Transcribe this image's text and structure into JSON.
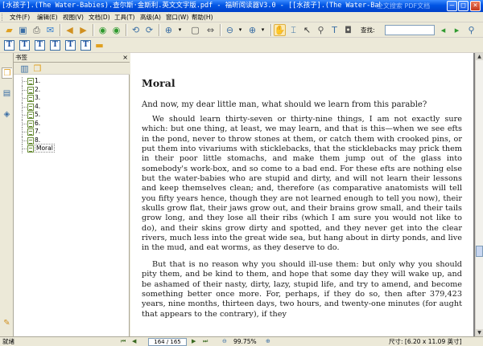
{
  "window": {
    "title": "[水孩子].(The Water-Babies).查尔斯·金斯利.英文文字版.pdf - 福昕阅读器V3.0 - [[水孩子].(The Water-Babies).查尔斯·金斯利...",
    "watermark": "全文搜索 PDF文档"
  },
  "menu": [
    "文件(F)",
    "编辑(E)",
    "视图(V)",
    "文档(D)",
    "工具(T)",
    "高级(A)",
    "窗口(W)",
    "帮助(H)"
  ],
  "toolbar": {
    "find_label": "查找:",
    "find_value": ""
  },
  "panel": {
    "title": "书签",
    "close": "×",
    "bookmarks": [
      "1.",
      "2.",
      "3.",
      "4.",
      "5.",
      "6.",
      "7.",
      "8.",
      "Moral"
    ],
    "selected_index": 8
  },
  "page": {
    "heading": "Moral",
    "intro": "And now, my dear little man, what should we learn from this parable?",
    "paragraphs": [
      "We should learn thirty-seven or thirty-nine things, I am not exactly sure which: but one thing, at least, we may learn, and that is this—when we see efts in the pond, never to throw stones at them, or catch them with crooked pins, or put them into vivariums with sticklebacks, that the sticklebacks may prick them in their poor little stomachs, and make them jump out of the glass into somebody's work-box, and so come to a bad end. For these efts are nothing else but the water-babies who are stupid and dirty, and will not learn their lessons and keep themselves clean; and, therefore (as comparative anatomists will tell you fifty years hence, though they are not learned enough to tell you now), their skulls grow flat, their jaws grow out, and their brains grow small, and their tails grow long, and they lose all their ribs (which I am sure you would not like to do), and their skins grow dirty and spotted, and they never get into the clear rivers, much less into the great wide sea, but hang about in dirty ponds, and live in the mud, and eat worms, as they deserve to do.",
      "But that is no reason why you should ill-use them: but only why you should pity them, and be kind to them, and hope that some day they will wake up, and be ashamed of their nasty, dirty, lazy, stupid life, and try to amend, and become something better once more. For, perhaps, if they do so, then after 379,423 years, nine months, thirteen days, two hours, and twenty-one minutes (for aught that appears to the contrary), if they"
    ]
  },
  "status": {
    "ready": "就绪",
    "page_display": "164 / 165",
    "zoom": "99.75%",
    "size": "尺寸: [6.20 x 11.09 英寸]"
  },
  "colors": {
    "titlebar": "#0054e3",
    "chrome": "#ece9d8",
    "doc_background": "#808080",
    "page": "#ffffff"
  }
}
